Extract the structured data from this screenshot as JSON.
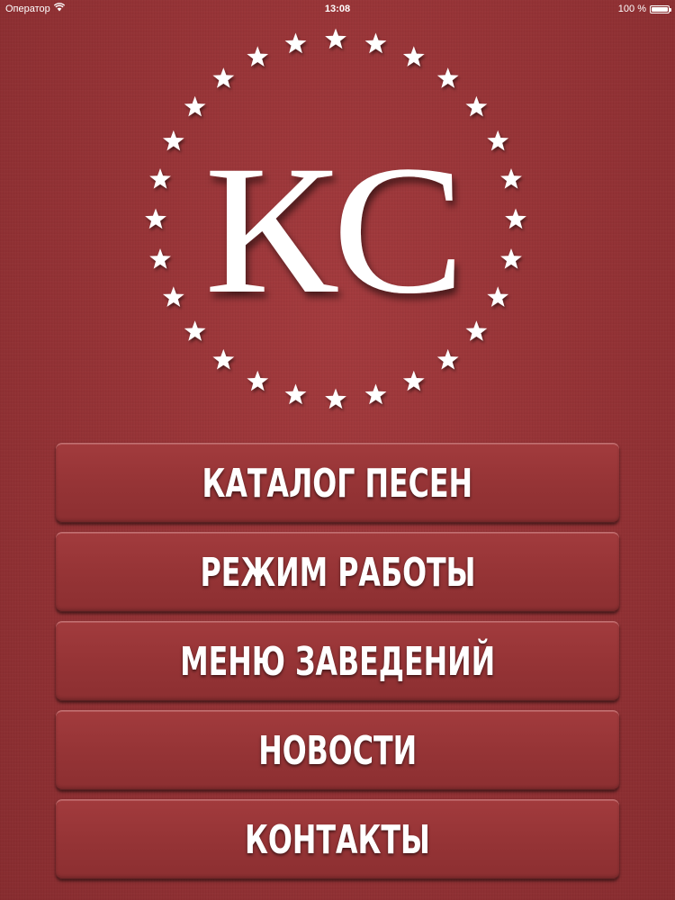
{
  "status_bar": {
    "carrier": "Оператор",
    "time": "13:08",
    "battery": "100 %",
    "battery_level": 1.0,
    "icons": [
      "wifi-icon",
      "battery-icon"
    ]
  },
  "logo": {
    "text": "КС",
    "star_count": 28,
    "color": "#ffffff"
  },
  "menu": {
    "items": [
      {
        "label": "КАТАЛОГ ПЕСЕН"
      },
      {
        "label": "РЕЖИМ РАБОТЫ"
      },
      {
        "label": "МЕНЮ ЗАВЕДЕНИЙ"
      },
      {
        "label": "НОВОСТИ"
      },
      {
        "label": "КОНТАКТЫ"
      }
    ]
  },
  "colors": {
    "background": "#973336",
    "button": "#963436",
    "text": "#ffffff"
  }
}
